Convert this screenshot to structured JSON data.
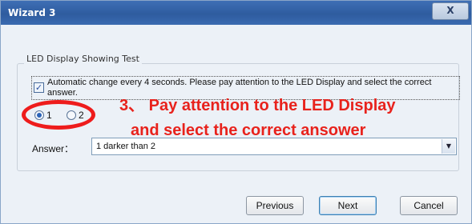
{
  "window": {
    "title": "Wizard 3",
    "close_glyph": "X"
  },
  "group": {
    "title": "LED Display Showing Test"
  },
  "auto_change": {
    "checked": true,
    "check_glyph": "✓",
    "text": "Automatic change every 4 seconds. Please pay attention to the LED Display and select the correct answer."
  },
  "radios": [
    {
      "label": "1",
      "checked": true
    },
    {
      "label": "2",
      "checked": false
    }
  ],
  "annotations": {
    "line1": "3、 Pay attention to the LED Display",
    "line2": "and select the correct ansower",
    "color": "#e8221c"
  },
  "answer": {
    "label": "Answer：",
    "value": "1 darker than 2",
    "arrow_glyph": "▼"
  },
  "buttons": {
    "previous": "Previous",
    "next": "Next",
    "cancel": "Cancel"
  }
}
